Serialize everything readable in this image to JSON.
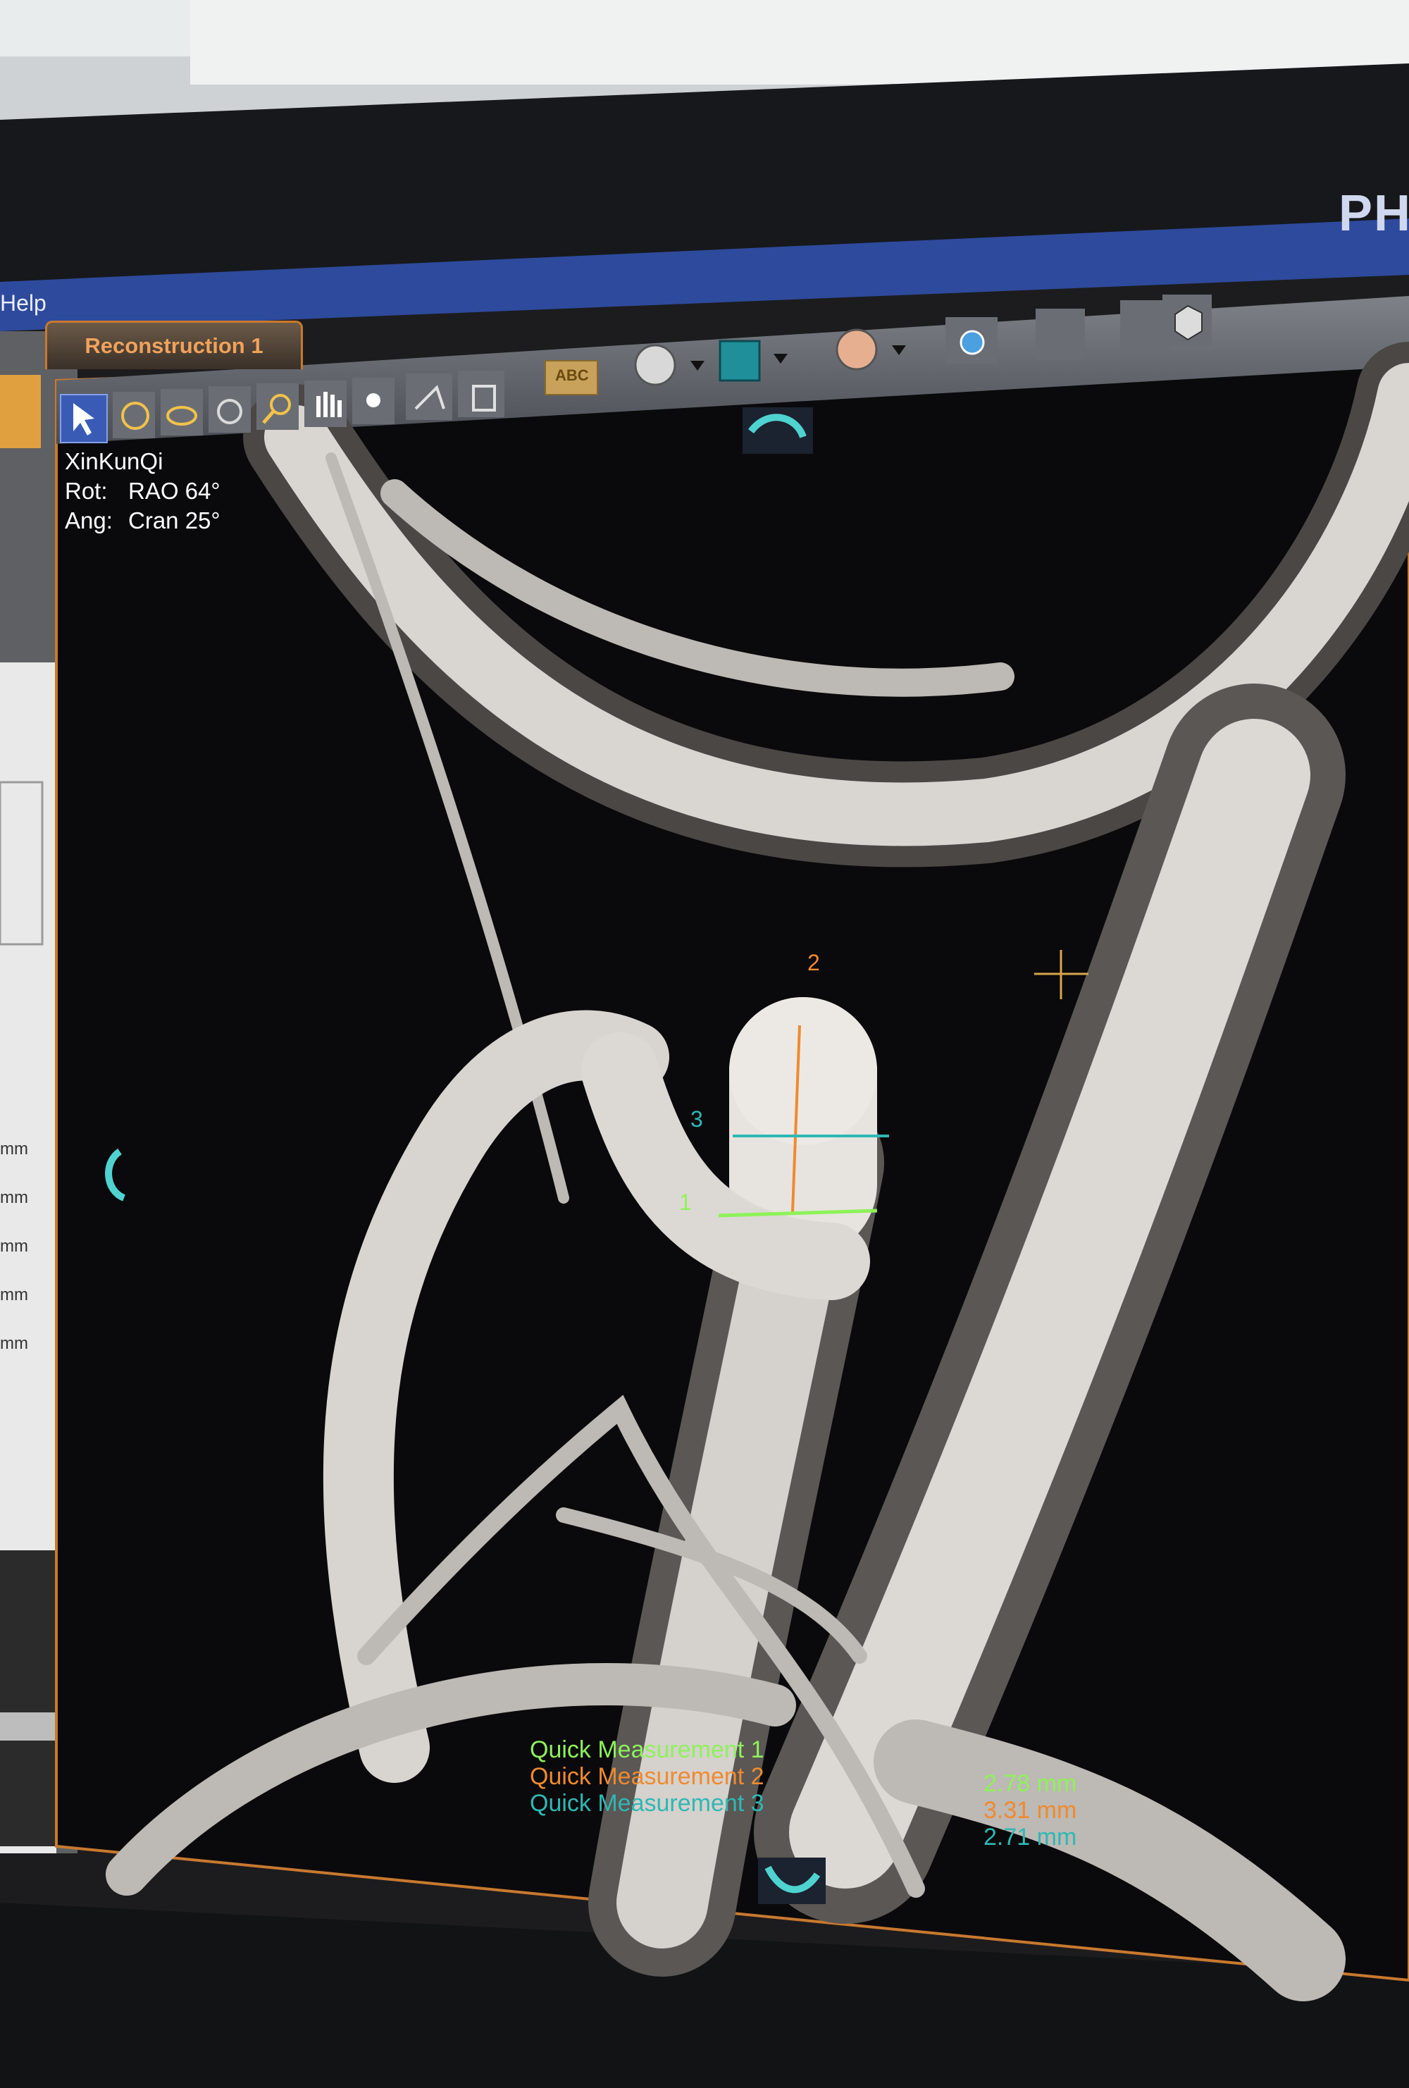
{
  "menu": {
    "help_label": "Help"
  },
  "brand": {
    "text": "PH"
  },
  "tab": {
    "label": "Reconstruction 1"
  },
  "toolbar": {
    "tools": [
      "select-arrow-icon",
      "rotate-3d-icon",
      "lasso-icon",
      "orbit-icon",
      "zoom-icon",
      "pan-hand-icon",
      "brightness-contrast-icon",
      "cut-plane-icon",
      "film-strip-icon"
    ],
    "annotate_label": "ABC"
  },
  "overlay": {
    "patient_name": "XinKunQi",
    "rot_label": "Rot:",
    "rot_value": "RAO 64°",
    "ang_label": "Ang:",
    "ang_value": "Cran 25°"
  },
  "markers": {
    "m1": "1",
    "m2": "2",
    "m3": "3"
  },
  "measurements": {
    "q1_label": "Quick Measurement 1",
    "q2_label": "Quick Measurement 2",
    "q3_label": "Quick Measurement 3",
    "q1_value": "2.78 mm",
    "q2_value": "3.31 mm",
    "q3_value": "2.71 mm"
  },
  "side_panel": {
    "units": [
      "mm",
      "mm",
      "mm",
      "mm",
      "mm"
    ]
  },
  "colors": {
    "measurement_1": "#8ef25a",
    "measurement_2": "#f08a2e",
    "measurement_3": "#2fb8b4",
    "accent_orange": "#c9792f",
    "toolbar_blue": "#3a5bb5"
  }
}
